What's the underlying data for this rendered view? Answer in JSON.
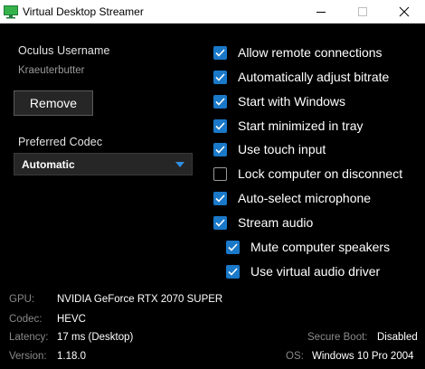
{
  "window": {
    "title": "Virtual Desktop Streamer",
    "icon": "virtual-desktop-app-icon"
  },
  "account": {
    "label": "Oculus Username",
    "username": "Kraeuterbutter",
    "remove_label": "Remove"
  },
  "codec": {
    "label": "Preferred Codec",
    "selected": "Automatic"
  },
  "options": [
    {
      "label": "Allow remote connections",
      "checked": true
    },
    {
      "label": "Automatically adjust bitrate",
      "checked": true
    },
    {
      "label": "Start with Windows",
      "checked": true
    },
    {
      "label": "Start minimized in tray",
      "checked": true
    },
    {
      "label": "Use touch input",
      "checked": true
    },
    {
      "label": "Lock computer on disconnect",
      "checked": false
    },
    {
      "label": "Auto-select microphone",
      "checked": true
    },
    {
      "label": "Stream audio",
      "checked": true
    },
    {
      "label": "Mute computer speakers",
      "checked": true
    },
    {
      "label": "Use virtual audio driver",
      "checked": true
    }
  ],
  "info": {
    "gpu_label": "GPU:",
    "gpu_value": "NVIDIA GeForce RTX 2070 SUPER",
    "codec_label": "Codec:",
    "codec_value": "HEVC",
    "latency_label": "Latency:",
    "latency_value": "17 ms (Desktop)",
    "version_label": "Version:",
    "version_value": "1.18.0",
    "secure_boot_label": "Secure Boot:",
    "secure_boot_value": "Disabled",
    "os_label": "OS:",
    "os_value": "Windows 10 Pro 2004"
  },
  "colors": {
    "background": "#000000",
    "accent": "#1a78c8",
    "control_bg": "#262626"
  }
}
